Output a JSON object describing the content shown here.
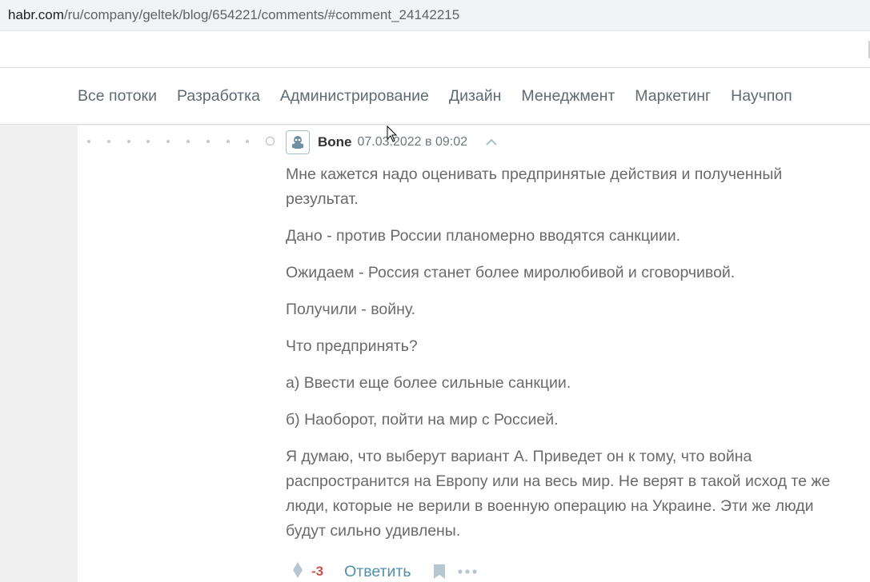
{
  "browser": {
    "url_domain": "habr.com",
    "url_path": "/ru/company/geltek/blog/654221/comments/#comment_24142215"
  },
  "nav": {
    "items": [
      "Все потоки",
      "Разработка",
      "Администрирование",
      "Дизайн",
      "Менеджмент",
      "Маркетинг",
      "Научпоп"
    ]
  },
  "comment": {
    "author": "Bone",
    "date": "07.03.2022 в 09:02",
    "paragraphs": [
      "Мне кажется надо оценивать предпринятые действия и полученный результат.",
      "Дано - против России планомерно вводятся санкциии.",
      "Ожидаем - Россия станет более миролюбивой и сговорчивой.",
      "Получили - войну.",
      "Что предпринять?",
      "а) Ввести еще более сильные санкции.",
      "б) Наоборот, пойти на мир с Россией.",
      "Я думаю, что выберут вариант А. Приведет он к тому, что война распространится на Европу или на весь мир. Не верят в такой исход те же люди, которые не верили в военную операцию на Украине. Эти же люди будут сильно удивлены."
    ],
    "score": "-3",
    "reply_label": "Ответить"
  },
  "icons": {
    "avatar": "robot-avatar-icon",
    "parent": "chevron-up-icon",
    "vote": "vote-diamond-icon",
    "bookmark": "bookmark-icon",
    "more": "more-dots-icon"
  },
  "colors": {
    "accent": "#548eaa",
    "negative_score": "#d04e4e",
    "text": "#6a6a6a"
  }
}
